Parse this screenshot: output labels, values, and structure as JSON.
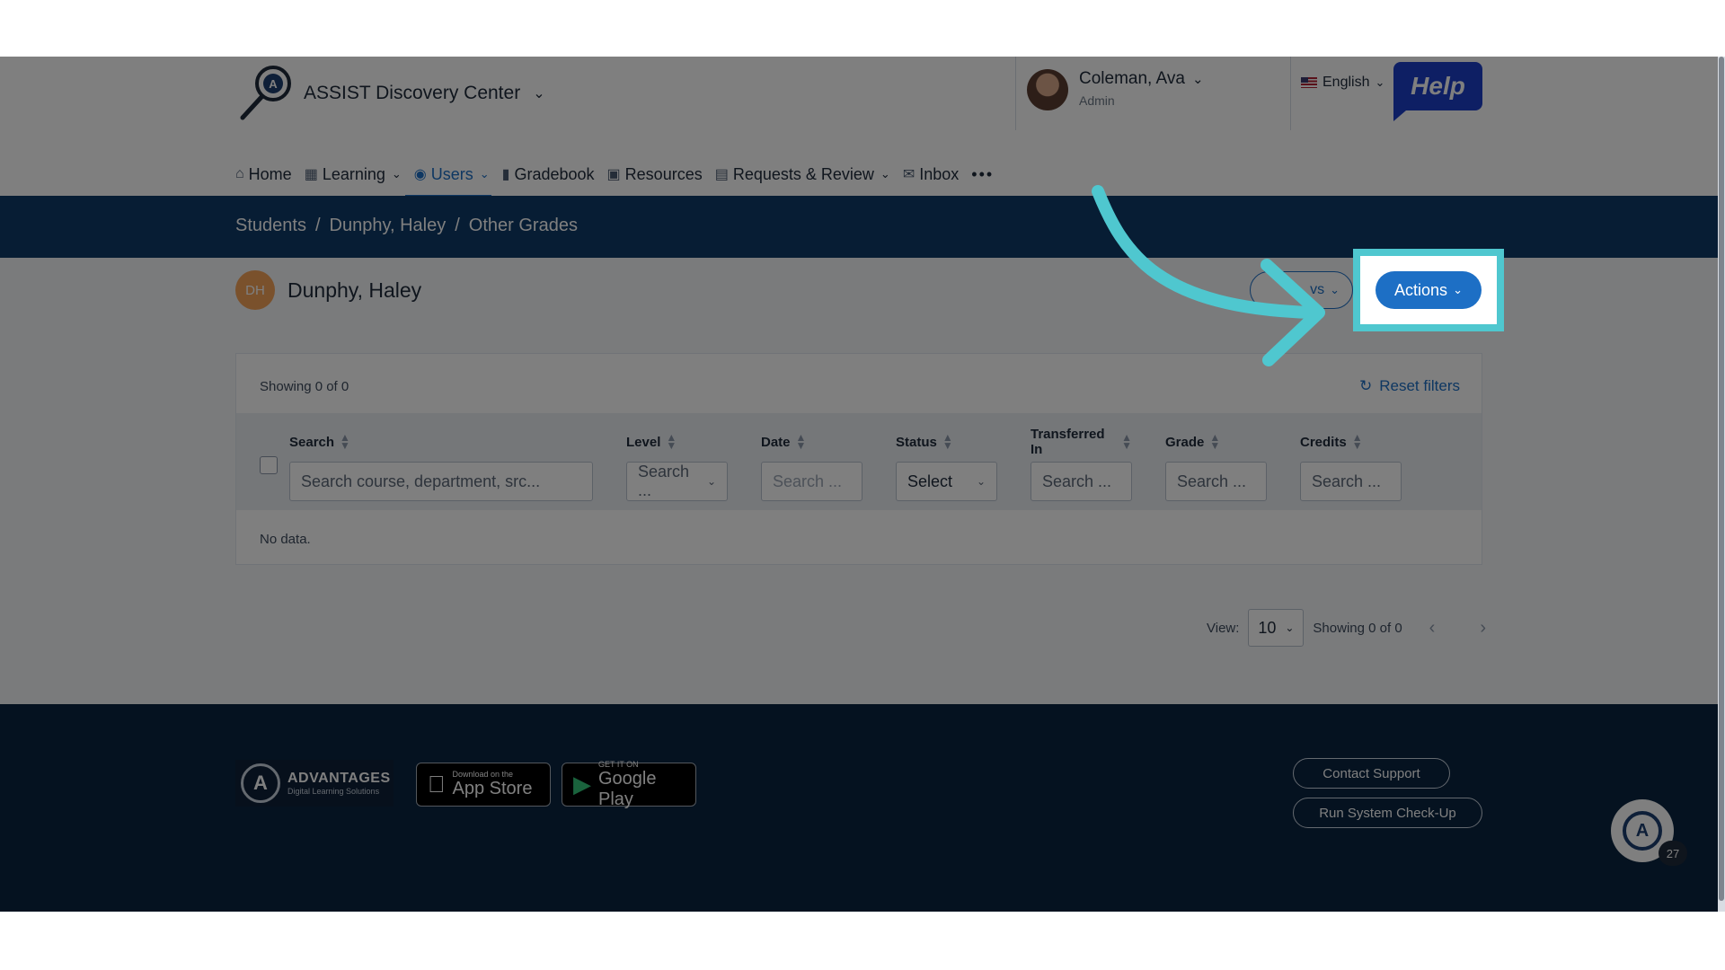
{
  "app": {
    "title": "ASSIST Discovery Center",
    "help_label": "Help"
  },
  "user": {
    "name": "Coleman, Ava",
    "role": "Admin"
  },
  "language": {
    "label": "English"
  },
  "nav": {
    "items": [
      {
        "label": "Home",
        "icon": "home-icon"
      },
      {
        "label": "Learning",
        "icon": "grid-icon"
      },
      {
        "label": "Users",
        "icon": "user-circle-icon"
      },
      {
        "label": "Gradebook",
        "icon": "book-icon"
      },
      {
        "label": "Resources",
        "icon": "monitor-icon"
      },
      {
        "label": "Requests & Review",
        "icon": "clipboard-icon"
      },
      {
        "label": "Inbox",
        "icon": "mail-icon"
      }
    ],
    "more_label": "•••",
    "active_index": 2
  },
  "breadcrumb": {
    "items": [
      "Students",
      "Dunphy, Haley",
      "Other Grades"
    ],
    "separator": "/"
  },
  "student": {
    "initials": "DH",
    "name": "Dunphy, Haley"
  },
  "views_button": {
    "label": "vs"
  },
  "actions_button": {
    "label": "Actions"
  },
  "table": {
    "showing_top": "Showing 0 of 0",
    "reset_label": "Reset filters",
    "columns": [
      {
        "label": "Search",
        "field": "Search course, department, src..."
      },
      {
        "label": "Level",
        "field": "Search ..."
      },
      {
        "label": "Date",
        "field": "Search ..."
      },
      {
        "label": "Status",
        "field": "Select"
      },
      {
        "label": "Transferred In",
        "field": "Search ..."
      },
      {
        "label": "Grade",
        "field": "Search ..."
      },
      {
        "label": "Credits",
        "field": "Search ..."
      }
    ],
    "empty_text": "No data."
  },
  "pagination": {
    "view_label": "View:",
    "page_size": "10",
    "showing": "Showing 0 of 0"
  },
  "footer": {
    "brand_name": "ADVANTAGES",
    "brand_tagline": "Digital Learning Solutions",
    "app_store_small": "Download on the",
    "app_store_big": "App Store",
    "google_small": "GET IT ON",
    "google_big": "Google Play",
    "contact_label": "Contact Support",
    "checkup_label": "Run System Check-Up"
  },
  "chat": {
    "badge_count": "27"
  },
  "colors": {
    "accent": "#1d6fc5",
    "crumb_bar": "#0e3a68",
    "highlight": "#4fc7cf",
    "footer": "#0a2440",
    "help": "#1d3fc9"
  }
}
